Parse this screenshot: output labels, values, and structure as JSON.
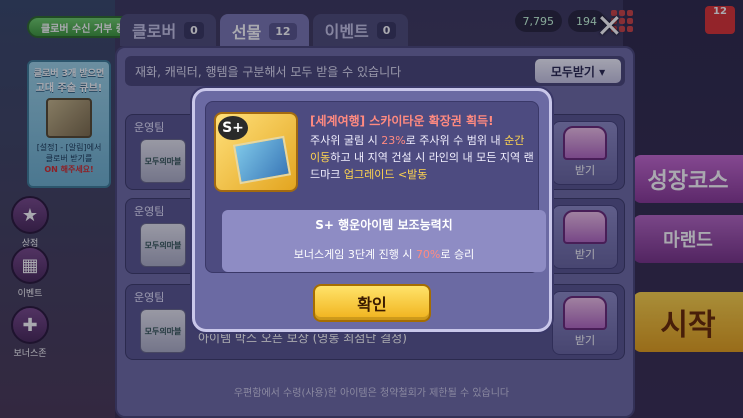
{
  "background": {
    "toggle_label": "클로버 수신 거부 중",
    "promo": {
      "line1": "클로버 3개 받으면",
      "line2": "고대 주술 큐브!",
      "line3a": "[설정] - [알림]에서",
      "line3b": "클로버 받기를",
      "line3c": "ON 해주세요!"
    },
    "sidebar": [
      {
        "label": "상점",
        "icon": "shop-icon"
      },
      {
        "label": "이벤트",
        "icon": "event-icon"
      },
      {
        "label": "보너스존",
        "icon": "gift-icon"
      }
    ],
    "coins": [
      "7,795",
      "194"
    ],
    "mail_count": "12",
    "right_buttons": [
      "성장코스",
      "마랜드",
      "시작"
    ]
  },
  "mailbox": {
    "tabs": [
      {
        "label": "클로버",
        "count": "0",
        "active": false
      },
      {
        "label": "선물",
        "count": "12",
        "active": true
      },
      {
        "label": "이벤트",
        "count": "0",
        "active": false
      }
    ],
    "hint": "재화, 캐릭터, 행템을 구분해서 모두 받을 수 있습니다",
    "claim_all_label": "모두받기 ▾",
    "rows": [
      {
        "sender": "운영팀",
        "desc": "",
        "claim": "받기",
        "thumb": "모두의마블"
      },
      {
        "sender": "운영팀",
        "desc": "",
        "claim": "받기",
        "thumb": "모두의마블"
      },
      {
        "sender": "운영팀",
        "desc": "아이템 박스 오픈 보상 (영롱 최첨단 결정)",
        "claim": "받기",
        "thumb": "모두의마블"
      }
    ],
    "footer": "우편함에서 수령(사용)한 아이템은 청약철회가 제한될 수 있습니다"
  },
  "modal": {
    "badge": "S+",
    "title": "[세계여행] 스카이타운 확장권 획득!",
    "desc_parts": {
      "a": "주사위 굴림 시 ",
      "b": "23%",
      "c": "로 주사위 수 범위 내 ",
      "d": "순간이동",
      "e": "하고 내 지역 건설 시 라인의 내 모든 지역 랜드마크 ",
      "f": "업그레이드 <발동"
    },
    "aux_title": "S+ 행운아이템 보조능력치",
    "aux_desc_a": "보너스게임 3단계 진행 시 ",
    "aux_desc_b": "70%",
    "aux_desc_c": "로 승리",
    "ok_label": "확인"
  }
}
